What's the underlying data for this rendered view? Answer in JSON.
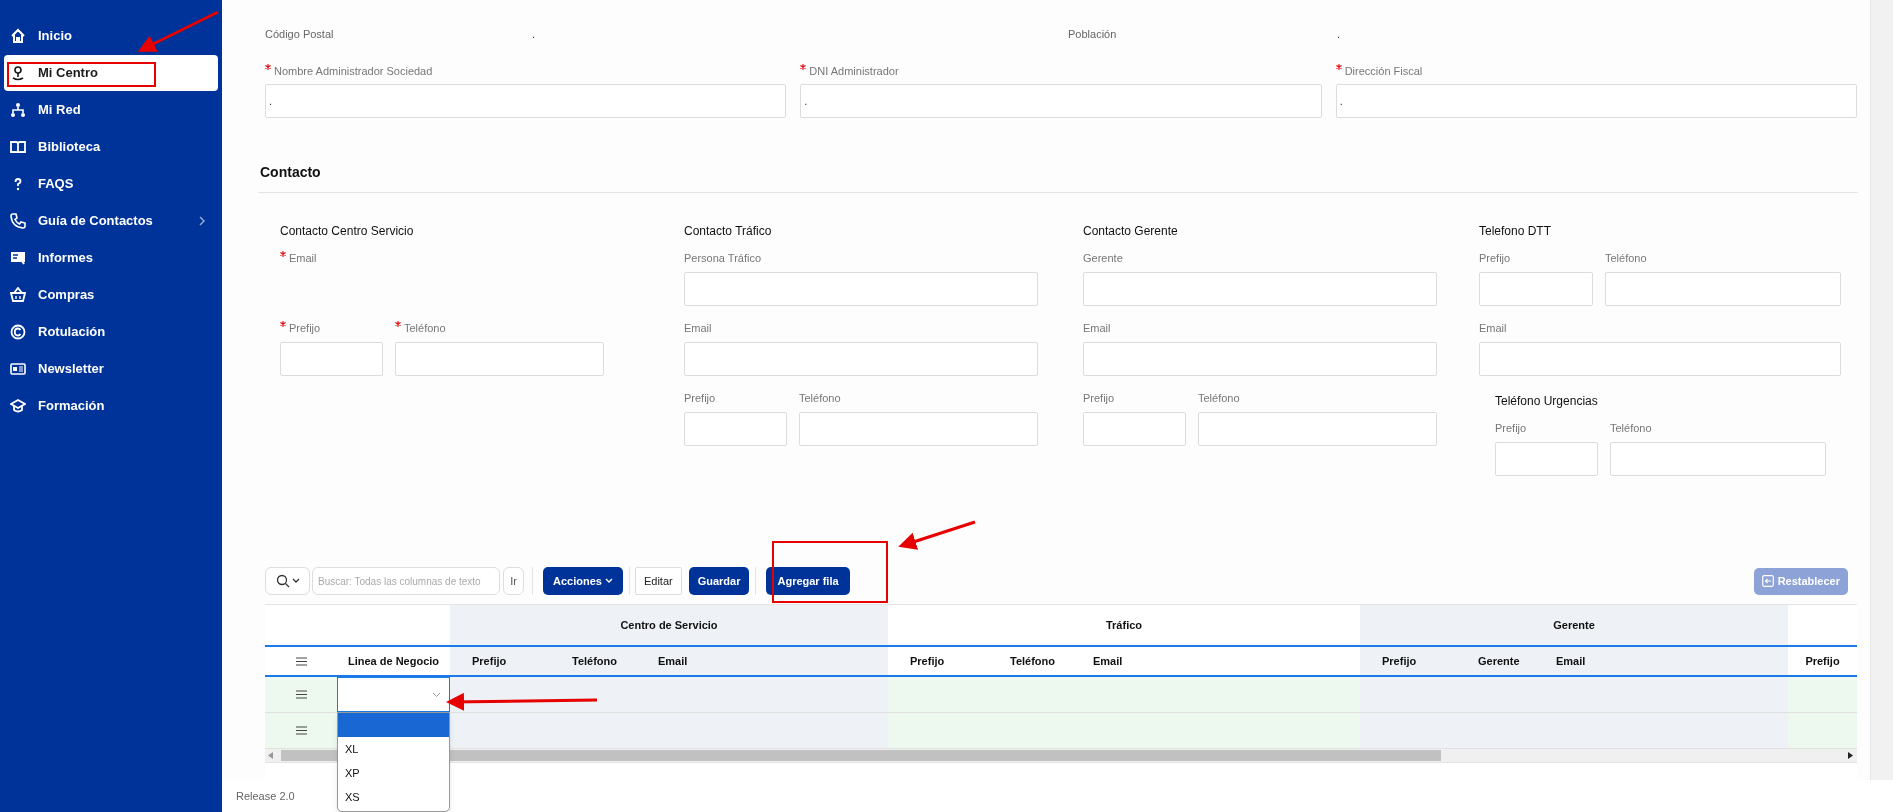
{
  "sidebar": {
    "items": [
      {
        "label": "Inicio",
        "kind": "home",
        "selected": false,
        "submenu": false
      },
      {
        "label": "Mi Centro",
        "kind": "pin",
        "selected": true,
        "submenu": false
      },
      {
        "label": "Mi Red",
        "kind": "network",
        "selected": false,
        "submenu": false
      },
      {
        "label": "Biblioteca",
        "kind": "book",
        "selected": false,
        "submenu": false
      },
      {
        "label": "FAQS",
        "kind": "question",
        "selected": false,
        "submenu": false
      },
      {
        "label": "Guía de Contactos",
        "kind": "phone",
        "selected": false,
        "submenu": true
      },
      {
        "label": "Informes",
        "kind": "report",
        "selected": false,
        "submenu": false
      },
      {
        "label": "Compras",
        "kind": "basket",
        "selected": false,
        "submenu": false
      },
      {
        "label": "Rotulación",
        "kind": "copyright",
        "selected": false,
        "submenu": false
      },
      {
        "label": "Newsletter",
        "kind": "newsletter",
        "selected": false,
        "submenu": false
      },
      {
        "label": "Formación",
        "kind": "cap",
        "selected": false,
        "submenu": false
      }
    ]
  },
  "info": [
    {
      "label": "Código Postal",
      "value": "."
    },
    {
      "label": "Población",
      "value": "."
    }
  ],
  "company_fields": [
    {
      "label": "Nombre Administrador Sociedad",
      "required": true,
      "value": "."
    },
    {
      "label": "DNI Administrador",
      "required": true,
      "value": "."
    },
    {
      "label": "Dirección Fiscal",
      "required": true,
      "value": "."
    }
  ],
  "contacto": {
    "title": "Contacto",
    "groups": [
      {
        "title": "Contacto Centro Servicio",
        "rows": [
          [
            {
              "label": "Email",
              "required": true,
              "kind": "label_only"
            }
          ],
          [
            {
              "label": "Prefijo",
              "required": true,
              "kind": "short"
            },
            {
              "label": "Teléfono",
              "required": true,
              "kind": "field"
            }
          ]
        ]
      },
      {
        "title": "Contacto Tráfico",
        "rows": [
          [
            {
              "label": "Persona Tráfico",
              "required": false,
              "kind": "field"
            }
          ],
          [
            {
              "label": "Email",
              "required": false,
              "kind": "field"
            }
          ],
          [
            {
              "label": "Prefijo",
              "required": false,
              "kind": "short"
            },
            {
              "label": "Teléfono",
              "required": false,
              "kind": "field"
            }
          ]
        ]
      },
      {
        "title": "Contacto Gerente",
        "rows": [
          [
            {
              "label": "Gerente",
              "required": false,
              "kind": "field"
            }
          ],
          [
            {
              "label": "Email",
              "required": false,
              "kind": "field"
            }
          ],
          [
            {
              "label": "Prefijo",
              "required": false,
              "kind": "short"
            },
            {
              "label": "Teléfono",
              "required": false,
              "kind": "field"
            }
          ]
        ]
      },
      {
        "title": "Telefono DTT",
        "rows": [
          [
            {
              "label": "Prefijo",
              "required": false,
              "kind": "short"
            },
            {
              "label": "Teléfono",
              "required": false,
              "kind": "field"
            }
          ],
          [
            {
              "label": "Email",
              "required": false,
              "kind": "field"
            }
          ]
        ],
        "subsection": {
          "title": "Teléfono Urgencias",
          "rows": [
            [
              {
                "label": "Prefijo",
                "required": false,
                "kind": "short"
              },
              {
                "label": "Teléfono",
                "required": false,
                "kind": "field"
              }
            ]
          ]
        }
      }
    ]
  },
  "toolbar": {
    "search_placeholder": "Buscar: Todas las columnas de texto",
    "go_label": "Ir",
    "buttons": [
      {
        "label": "Acciones",
        "kind": "primary",
        "caret": true
      },
      {
        "label": "Editar",
        "kind": "outline",
        "caret": false
      },
      {
        "label": "Guardar",
        "kind": "primary",
        "caret": false
      },
      {
        "label": "Agregar fila",
        "kind": "primary",
        "caret": false
      }
    ],
    "reset": {
      "label": "Restablecer",
      "disabled": true
    }
  },
  "grid": {
    "groups": [
      {
        "columns": [
          "Linea de Negocio"
        ],
        "kind": "plain"
      },
      {
        "label": "Centro de Servicio",
        "columns": [
          "Prefijo",
          "Teléfono",
          "Email"
        ],
        "kind": "shaded"
      },
      {
        "label": "Tráfico",
        "columns": [
          "Prefijo",
          "Teléfono",
          "Email"
        ],
        "kind": "plain"
      },
      {
        "label": "Gerente",
        "columns": [
          "Prefijo",
          "Gerente",
          "Email"
        ],
        "kind": "shaded"
      },
      {
        "columns": [
          "Prefijo"
        ],
        "kind": "plain"
      }
    ],
    "rows": [
      {
        "editing": true
      },
      {}
    ],
    "dropdown": {
      "options": [
        {
          "blank": true,
          "selected": true
        },
        {
          "label": "XL",
          "selected": false
        },
        {
          "label": "XP",
          "selected": false
        },
        {
          "label": "XS",
          "selected": false
        }
      ]
    }
  },
  "footer": {
    "release": "Release 2.0"
  }
}
